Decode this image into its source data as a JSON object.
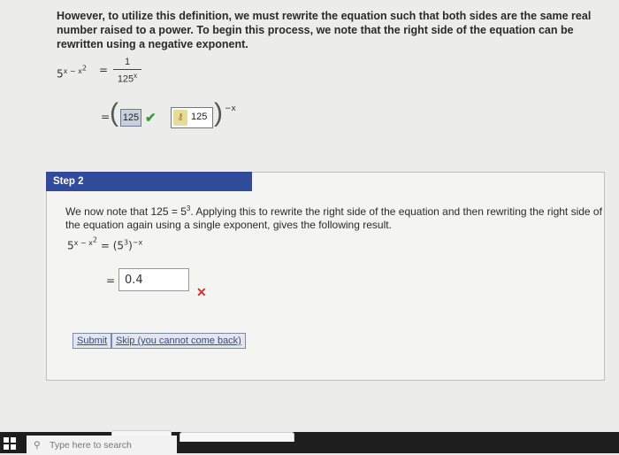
{
  "intro": {
    "text": "However, to utilize this definition, we must rewrite the equation such that both sides are the same real number raised to a power. To begin this process, we note that the right side of the equation can be rewritten using a negative exponent."
  },
  "eq1": {
    "lhs_base": "5",
    "lhs_exp": "x − x",
    "lhs_exp_sq": "2",
    "equals": "=",
    "numerator": "1",
    "denominator_base": "125",
    "denominator_exp": "x"
  },
  "eq2": {
    "equals": "=",
    "box1_value": "125",
    "box2_value": "125",
    "outer_exp": "−x"
  },
  "step2": {
    "header": "Step 2",
    "text_a": "We now note that 125 = 5",
    "text_a_exp": "3",
    "text_b": ". Applying this to rewrite the right side of the equation and then rewriting the right side of the equation again using a single exponent, gives the following result.",
    "eq_lhs": "5",
    "eq_lhs_exp": "x − x",
    "eq_lhs_exp_sq": "2",
    "eq_rhs": "= (5",
    "eq_rhs_inner_exp": "3",
    "eq_rhs_close": ")",
    "eq_rhs_exp": "−x",
    "answer_equals": "=",
    "answer_value": "0.4"
  },
  "buttons": {
    "submit": "Submit",
    "skip": "Skip (you cannot come back)"
  },
  "taskbar": {
    "search_placeholder": "Type here to search"
  },
  "colors": {
    "step_header": "#2f4b9a",
    "check": "#3a9a3a",
    "wrong": "#d23333"
  }
}
